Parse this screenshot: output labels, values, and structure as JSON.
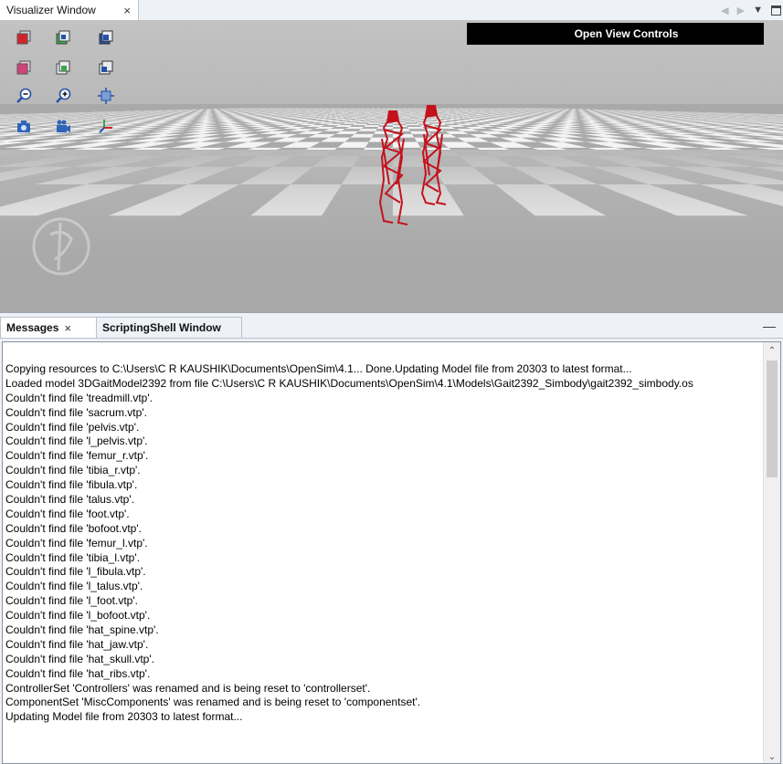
{
  "top_tabs": {
    "visualizer_label": "Visualizer Window",
    "close_glyph": "×"
  },
  "viewport": {
    "open_view_controls_label": "Open View Controls",
    "toolbar_icons": [
      "view-front-icon",
      "view-back-icon",
      "view-top-icon",
      "view-bottom-icon",
      "view-left-icon",
      "view-right-icon",
      "zoom-out-icon",
      "zoom-in-icon",
      "fit-all-icon",
      "snapshot-icon",
      "record-movie-icon",
      "axes-toggle-icon"
    ],
    "accent_colors": {
      "model": "#c4121c",
      "toolbar_blue": "#2452a8",
      "toolbar_red": "#d2222a"
    }
  },
  "bottom_tabs": {
    "messages_label": "Messages",
    "scripting_label": "ScriptingShell Window",
    "close_glyph": "×",
    "minimize_glyph": "—"
  },
  "messages": [
    "Copying resources to C:\\Users\\C R KAUSHIK\\Documents\\OpenSim\\4.1... Done.Updating Model file from 20303 to latest format...",
    "Loaded model 3DGaitModel2392 from file C:\\Users\\C R KAUSHIK\\Documents\\OpenSim\\4.1\\Models\\Gait2392_Simbody\\gait2392_simbody.os",
    "Couldn't find file 'treadmill.vtp'.",
    "Couldn't find file 'sacrum.vtp'.",
    "Couldn't find file 'pelvis.vtp'.",
    "Couldn't find file 'l_pelvis.vtp'.",
    "Couldn't find file 'femur_r.vtp'.",
    "Couldn't find file 'tibia_r.vtp'.",
    "Couldn't find file 'fibula.vtp'.",
    "Couldn't find file 'talus.vtp'.",
    "Couldn't find file 'foot.vtp'.",
    "Couldn't find file 'bofoot.vtp'.",
    "Couldn't find file 'femur_l.vtp'.",
    "Couldn't find file 'tibia_l.vtp'.",
    "Couldn't find file 'l_fibula.vtp'.",
    "Couldn't find file 'l_talus.vtp'.",
    "Couldn't find file 'l_foot.vtp'.",
    "Couldn't find file 'l_bofoot.vtp'.",
    "Couldn't find file 'hat_spine.vtp'.",
    "Couldn't find file 'hat_jaw.vtp'.",
    "Couldn't find file 'hat_skull.vtp'.",
    "Couldn't find file 'hat_ribs.vtp'.",
    "ControllerSet 'Controllers' was renamed and is being reset to 'controllerset'.",
    "ComponentSet 'MiscComponents' was renamed and is being reset to 'componentset'.",
    "Updating Model file from 20303 to latest format..."
  ]
}
